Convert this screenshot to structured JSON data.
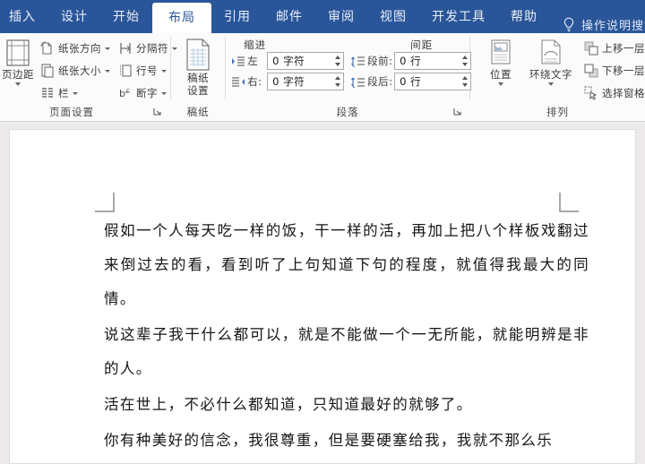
{
  "ribbon": {
    "tabs": [
      {
        "label": "插入",
        "active": false
      },
      {
        "label": "设计",
        "active": false
      },
      {
        "label": "开始",
        "active": false
      },
      {
        "label": "布局",
        "active": true
      },
      {
        "label": "引用",
        "active": false
      },
      {
        "label": "邮件",
        "active": false
      },
      {
        "label": "审阅",
        "active": false
      },
      {
        "label": "视图",
        "active": false
      },
      {
        "label": "开发工具",
        "active": false
      },
      {
        "label": "帮助",
        "active": false
      }
    ],
    "help": {
      "icon": "lightbulb-icon",
      "placeholder": "操作说明搜索"
    },
    "colors": {
      "ribbon_blue": "#2a5699",
      "highlight_red": "#e8312b",
      "ribbon_body": "#fbfbfb",
      "canvas_gray": "#eceaea"
    },
    "groups": {
      "page_setup": {
        "label": "页面设置",
        "margins_button": {
          "label": "页边距",
          "icon": "page-margins-icon"
        },
        "items": [
          {
            "label": "纸张方向",
            "icon": "paper-orientation-icon"
          },
          {
            "label": "纸张大小",
            "icon": "paper-size-icon"
          },
          {
            "label": "栏",
            "icon": "columns-icon"
          },
          {
            "label": "分隔符",
            "icon": "breaks-icon"
          },
          {
            "label": "行号",
            "icon": "line-numbers-icon"
          },
          {
            "label": "断字",
            "icon": "hyphenation-icon"
          }
        ],
        "launcher_highlighted": true
      },
      "manuscript": {
        "label": "稿纸",
        "button": {
          "label_line1": "稿纸",
          "label_line2": "设置",
          "icon": "manuscript-paper-icon"
        }
      },
      "paragraph": {
        "label": "段落",
        "heading_indent": "缩进",
        "heading_spacing": "间距",
        "fields": [
          {
            "name": "indent-left",
            "label": "左",
            "value": "0 字符",
            "icon": "indent-left-icon"
          },
          {
            "name": "indent-right",
            "label": "右:",
            "value": "0 字符",
            "icon": "indent-right-icon"
          },
          {
            "name": "spacing-before",
            "label": "段前:",
            "value": "0 行",
            "icon": "spacing-before-icon"
          },
          {
            "name": "spacing-after",
            "label": "段后:",
            "value": "0 行",
            "icon": "spacing-after-icon"
          }
        ]
      },
      "arrange": {
        "label": "排列",
        "big_items": [
          {
            "label": "位置",
            "icon": "position-icon"
          },
          {
            "label": "环绕文字",
            "icon": "wrap-text-icon"
          }
        ],
        "small_items": [
          {
            "label": "上移一层",
            "icon": "bring-forward-icon"
          },
          {
            "label": "下移一层",
            "icon": "send-backward-icon"
          },
          {
            "label": "选择窗格",
            "icon": "selection-pane-icon"
          }
        ]
      }
    }
  },
  "document": {
    "paragraphs": [
      "假如一个人每天吃一样的饭，干一样的活，再加上把八个样板戏翻过来倒过去的看，看到听了上句知道下句的程度，就值得我最大的同情。",
      "说这辈子我干什么都可以，就是不能做一个一无所能，就能明辨是非的人。",
      "活在世上，不必什么都知道，只知道最好的就够了。",
      "你有种美好的信念，我很尊重，但是要硬塞给我，我就不那么乐"
    ]
  }
}
